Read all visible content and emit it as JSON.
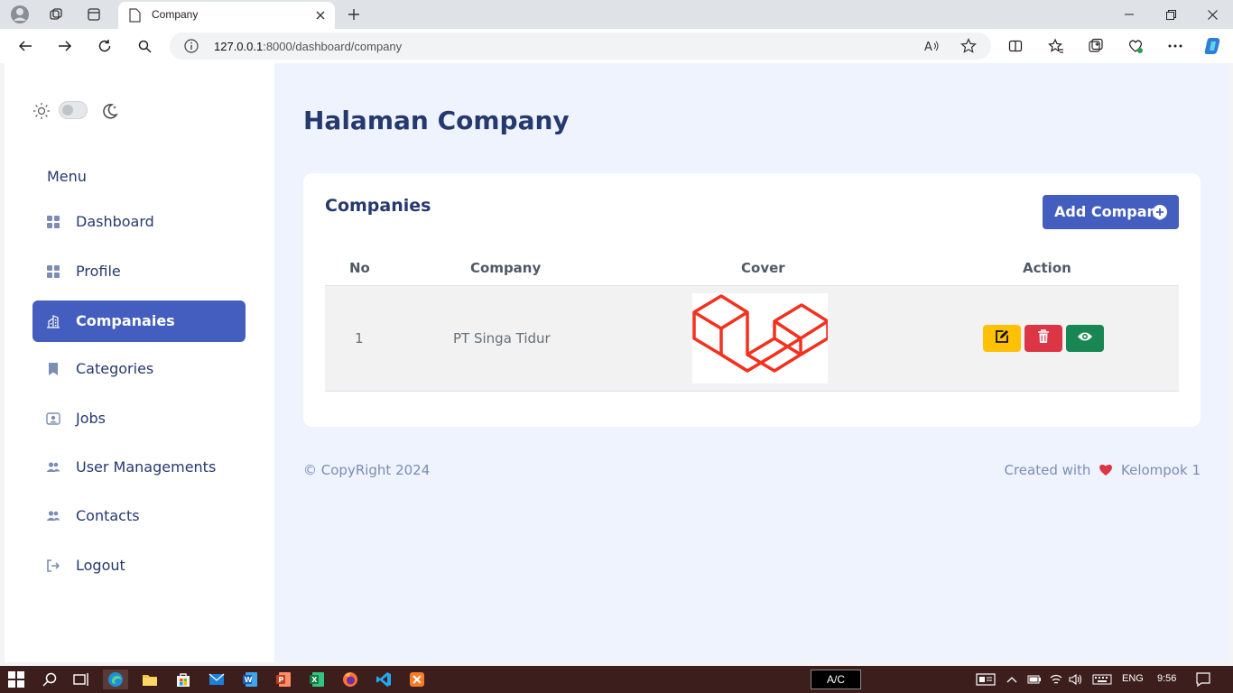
{
  "browser": {
    "tab_title": "Company",
    "url_host": "127.0.0.1",
    "url_path": ":8000/dashboard/company"
  },
  "sidebar": {
    "menu_title": "Menu",
    "items": [
      {
        "label": "Dashboard",
        "icon": "grid-icon"
      },
      {
        "label": "Profile",
        "icon": "grid-icon"
      },
      {
        "label": "Companaies",
        "icon": "building-icon",
        "active": true
      },
      {
        "label": "Categories",
        "icon": "bookmark-icon"
      },
      {
        "label": "Jobs",
        "icon": "person-badge-icon"
      },
      {
        "label": "User Managements",
        "icon": "people-icon"
      },
      {
        "label": "Contacts",
        "icon": "people-icon"
      },
      {
        "label": "Logout",
        "icon": "logout-icon"
      }
    ]
  },
  "main": {
    "page_title": "Halaman Company",
    "card_title": "Companies",
    "add_button": "Add Company",
    "table": {
      "headers": [
        "No",
        "Company",
        "Cover",
        "Action"
      ],
      "rows": [
        {
          "no": "1",
          "company": "PT Singa Tidur",
          "cover": "laravel-logo"
        }
      ]
    }
  },
  "footer": {
    "left": "© CopyRight 2024",
    "right_prefix": "Created with",
    "right_suffix": "Kelompok 1"
  },
  "taskbar": {
    "ac_label": "A/C",
    "lang": "ENG",
    "time": "9:56"
  },
  "colors": {
    "primary": "#435ebe",
    "text_dark": "#25396f",
    "edit": "#ffc107",
    "delete": "#dc3545",
    "view": "#198754"
  }
}
